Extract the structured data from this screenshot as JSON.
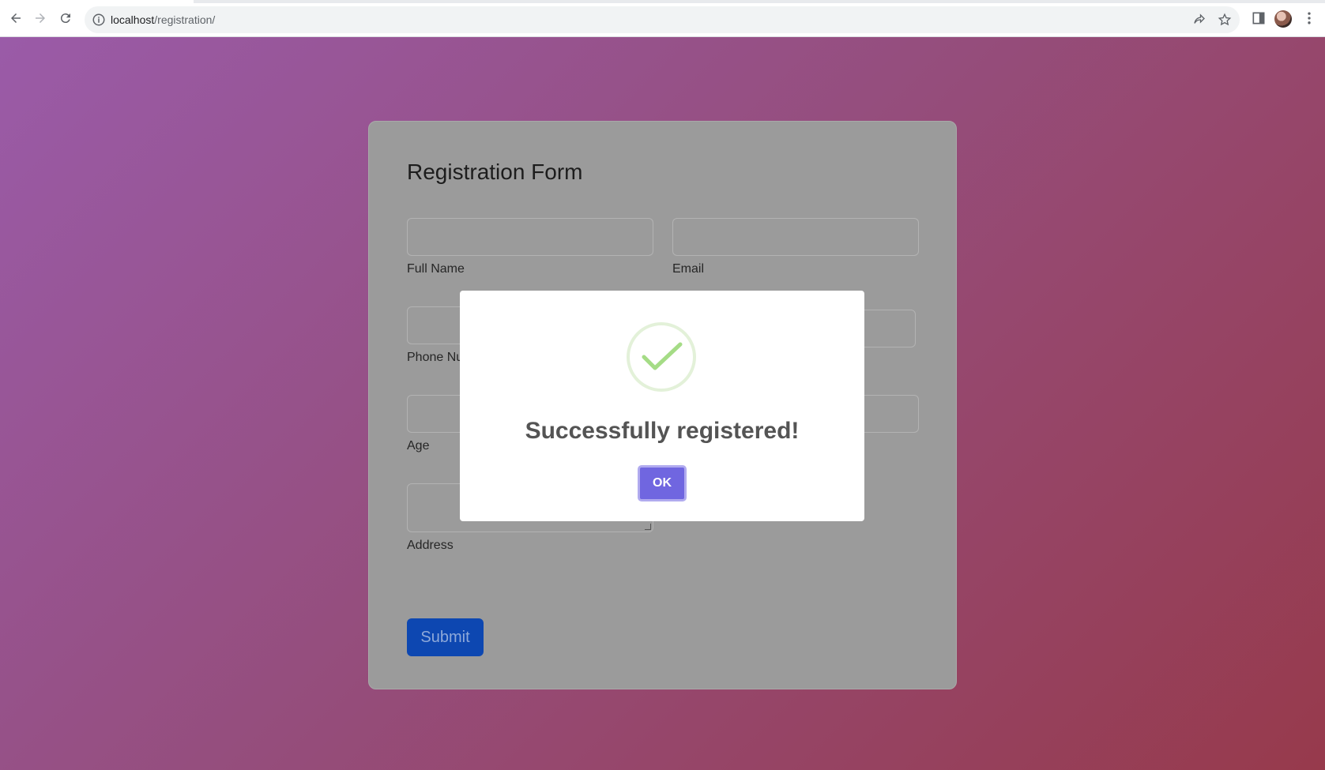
{
  "browser": {
    "url_host": "localhost",
    "url_path": "/registration/"
  },
  "form": {
    "title": "Registration Form",
    "fields": [
      {
        "label": "Full Name",
        "value": ""
      },
      {
        "label": "Email",
        "value": ""
      },
      {
        "label": "Phone Nu",
        "value": ""
      },
      {
        "label": "Age",
        "value": ""
      },
      {
        "label": "Address",
        "value": ""
      }
    ],
    "submit_label": "Submit"
  },
  "modal": {
    "message": "Successfully registered!",
    "ok_label": "OK"
  }
}
